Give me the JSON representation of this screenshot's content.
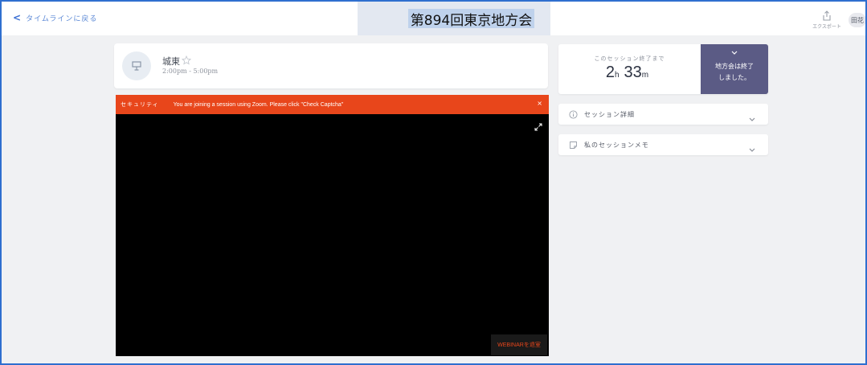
{
  "header": {
    "back_label": "タイムラインに戻る",
    "title": "第894回東京地方会",
    "export_label": "エクスポート",
    "avatar_text": "田花"
  },
  "session": {
    "name": "城東",
    "time": "2:00pm - 5:00pm"
  },
  "video": {
    "alert_tag": "セキュリティ",
    "alert_message": "You are joining a session using Zoom. Please click \"Check Captcha\"",
    "alert_close": "×",
    "webinar_button": "WEBINARを退室"
  },
  "timer": {
    "label": "このセッション終了まで",
    "hours": "2",
    "hours_unit": "h",
    "minutes": "33",
    "minutes_unit": "m",
    "ended_line1": "地方会は終了",
    "ended_line2": "しました。"
  },
  "panels": {
    "details_label": "セッション詳細",
    "notes_label": "私のセッションメモ"
  },
  "colors": {
    "accent": "#3b6fd4",
    "alert": "#e8461b",
    "ended_bg": "#5b5b85"
  }
}
